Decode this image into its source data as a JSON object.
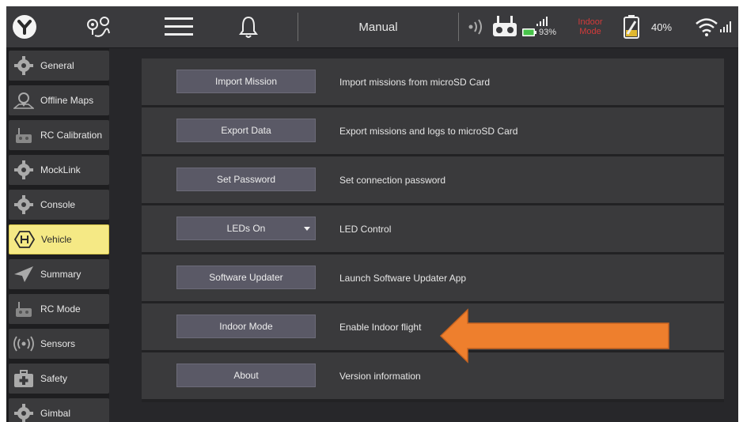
{
  "topbar": {
    "mode": "Manual",
    "controller_battery": "93%",
    "indoor_mode_line1": "Indoor",
    "indoor_mode_line2": "Mode",
    "vehicle_battery": "40%",
    "indoor_color": "#d23a3a"
  },
  "sidebar": {
    "items": [
      {
        "label": "General",
        "icon": "gear-icon"
      },
      {
        "label": "Offline Maps",
        "icon": "map-pin-icon"
      },
      {
        "label": "RC Calibration",
        "icon": "remote-controller-icon"
      },
      {
        "label": "MockLink",
        "icon": "gear-icon"
      },
      {
        "label": "Console",
        "icon": "gear-icon"
      },
      {
        "label": "Vehicle",
        "icon": "vehicle-hex-icon"
      },
      {
        "label": "Summary",
        "icon": "paper-plane-icon"
      },
      {
        "label": "RC Mode",
        "icon": "remote-controller-icon"
      },
      {
        "label": "Sensors",
        "icon": "sensor-waves-icon"
      },
      {
        "label": "Safety",
        "icon": "medical-kit-icon"
      },
      {
        "label": "Gimbal",
        "icon": "gear-icon"
      }
    ],
    "active_color": "#f5e985"
  },
  "rows": [
    {
      "button": "Import Mission",
      "description": "Import missions from microSD Card"
    },
    {
      "button": "Export Data",
      "description": "Export missions and logs to microSD Card"
    },
    {
      "button": "Set Password",
      "description": "Set connection password"
    },
    {
      "button": "LEDs On",
      "description": "LED Control"
    },
    {
      "button": "Software Updater",
      "description": "Launch Software Updater App"
    },
    {
      "button": "Indoor Mode",
      "description": "Enable Indoor flight"
    },
    {
      "button": "About",
      "description": "Version information"
    }
  ],
  "annotation": {
    "arrow_color": "#ee7f2d"
  }
}
